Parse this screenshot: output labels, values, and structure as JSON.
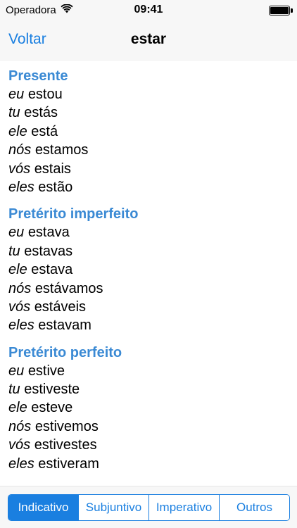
{
  "status_bar": {
    "carrier": "Operadora",
    "time": "09:41",
    "wifi_icon": "wifi-icon",
    "battery_icon": "battery-icon",
    "battery_level": 1.0
  },
  "nav": {
    "back_label": "Voltar",
    "title": "estar"
  },
  "sections": [
    {
      "title": "Presente",
      "rows": [
        {
          "pronoun": "eu",
          "form": "estou"
        },
        {
          "pronoun": "tu",
          "form": "estás"
        },
        {
          "pronoun": "ele",
          "form": "está"
        },
        {
          "pronoun": "nós",
          "form": "estamos"
        },
        {
          "pronoun": "vós",
          "form": "estais"
        },
        {
          "pronoun": "eles",
          "form": "estão"
        }
      ]
    },
    {
      "title": "Pretérito imperfeito",
      "rows": [
        {
          "pronoun": "eu",
          "form": "estava"
        },
        {
          "pronoun": "tu",
          "form": "estavas"
        },
        {
          "pronoun": "ele",
          "form": "estava"
        },
        {
          "pronoun": "nós",
          "form": "estávamos"
        },
        {
          "pronoun": "vós",
          "form": "estáveis"
        },
        {
          "pronoun": "eles",
          "form": "estavam"
        }
      ]
    },
    {
      "title": "Pretérito perfeito",
      "rows": [
        {
          "pronoun": "eu",
          "form": "estive"
        },
        {
          "pronoun": "tu",
          "form": "estiveste"
        },
        {
          "pronoun": "ele",
          "form": "esteve"
        },
        {
          "pronoun": "nós",
          "form": "estivemos"
        },
        {
          "pronoun": "vós",
          "form": "estivestes"
        },
        {
          "pronoun": "eles",
          "form": "estiveram"
        }
      ]
    }
  ],
  "segments": {
    "items": [
      "Indicativo",
      "Subjuntivo",
      "Imperativo",
      "Outros"
    ],
    "selected": "Indicativo"
  },
  "colors": {
    "accent": "#1a7fe0",
    "section_title": "#3b8ad4",
    "bar_background": "#f7f7f7"
  }
}
